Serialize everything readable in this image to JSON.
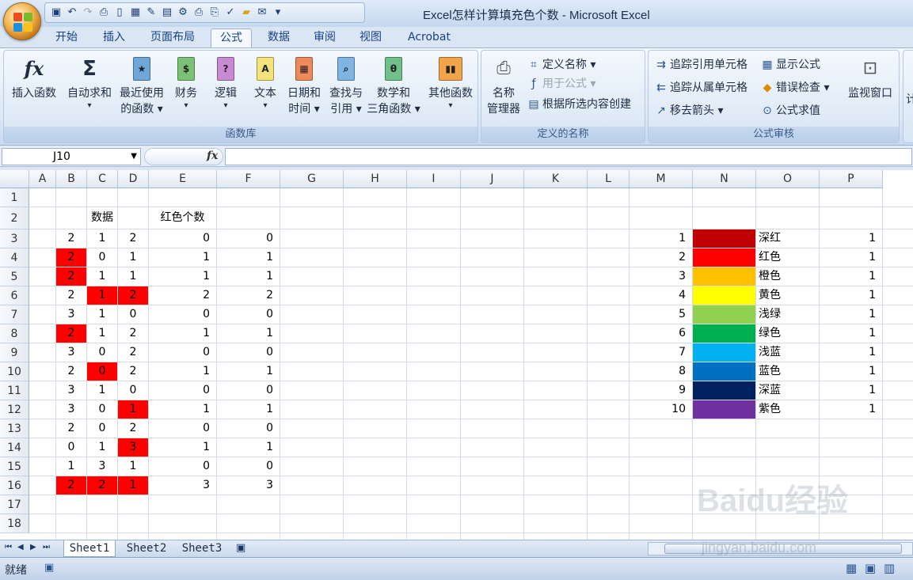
{
  "window": {
    "title": "Excel怎样计算填充色个数 - Microsoft Excel"
  },
  "tabs": [
    "开始",
    "插入",
    "页面布局",
    "公式",
    "数据",
    "审阅",
    "视图",
    "Acrobat"
  ],
  "active_tab": "公式",
  "ribbon": {
    "function_library": {
      "label": "函数库",
      "buttons": [
        {
          "line1": "插入函数",
          "line2": ""
        },
        {
          "line1": "自动求和",
          "line2": "▾"
        },
        {
          "line1": "最近使用",
          "line2": "的函数 ▾"
        },
        {
          "line1": "财务",
          "line2": "▾"
        },
        {
          "line1": "逻辑",
          "line2": "▾"
        },
        {
          "line1": "文本",
          "line2": "▾"
        },
        {
          "line1": "日期和",
          "line2": "时间 ▾"
        },
        {
          "line1": "查找与",
          "line2": "引用 ▾"
        },
        {
          "line1": "数学和",
          "line2": "三角函数 ▾"
        },
        {
          "line1": "其他函数",
          "line2": "▾"
        }
      ]
    },
    "defined_names": {
      "label": "定义的名称",
      "name_manager": {
        "line1": "名称",
        "line2": "管理器"
      },
      "define_name": "定义名称 ▾",
      "use_in_formula": "用于公式 ▾",
      "create_from_selection": "根据所选内容创建"
    },
    "formula_auditing": {
      "label": "公式审核",
      "trace_precedents": "追踪引用单元格",
      "trace_dependents": "追踪从属单元格",
      "remove_arrows": "移去箭头 ▾",
      "show_formulas": "显示公式",
      "error_checking": "错误检查 ▾",
      "evaluate_formula": "公式求值",
      "watch_window": "监视窗口"
    }
  },
  "formula_bar": {
    "name_box": "J10",
    "fx": "fx",
    "formula": ""
  },
  "columns": [
    "A",
    "B",
    "C",
    "D",
    "E",
    "F",
    "G",
    "H",
    "I",
    "J",
    "K",
    "L",
    "M",
    "N",
    "O",
    "P"
  ],
  "rows": [
    "1",
    "2",
    "3",
    "4",
    "5",
    "6",
    "7",
    "8",
    "9",
    "10",
    "11",
    "12",
    "13",
    "14",
    "15",
    "16",
    "17",
    "18"
  ],
  "headers": {
    "data": "数据",
    "red_count": "红色个数"
  },
  "data_rows": [
    {
      "b": "2",
      "c": "1",
      "d": "2",
      "e": "0",
      "f": "0",
      "red": [
        false,
        false,
        false
      ]
    },
    {
      "b": "2",
      "c": "0",
      "d": "1",
      "e": "1",
      "f": "1",
      "red": [
        true,
        false,
        false
      ]
    },
    {
      "b": "2",
      "c": "1",
      "d": "1",
      "e": "1",
      "f": "1",
      "red": [
        true,
        false,
        false
      ]
    },
    {
      "b": "2",
      "c": "1",
      "d": "2",
      "e": "2",
      "f": "2",
      "red": [
        false,
        true,
        true
      ]
    },
    {
      "b": "3",
      "c": "1",
      "d": "0",
      "e": "0",
      "f": "0",
      "red": [
        false,
        false,
        false
      ]
    },
    {
      "b": "2",
      "c": "1",
      "d": "2",
      "e": "1",
      "f": "1",
      "red": [
        true,
        false,
        false
      ]
    },
    {
      "b": "3",
      "c": "0",
      "d": "2",
      "e": "0",
      "f": "0",
      "red": [
        false,
        false,
        false
      ]
    },
    {
      "b": "2",
      "c": "0",
      "d": "2",
      "e": "1",
      "f": "1",
      "red": [
        false,
        true,
        false
      ]
    },
    {
      "b": "3",
      "c": "1",
      "d": "0",
      "e": "0",
      "f": "0",
      "red": [
        false,
        false,
        false
      ]
    },
    {
      "b": "3",
      "c": "0",
      "d": "1",
      "e": "1",
      "f": "1",
      "red": [
        false,
        false,
        true
      ]
    },
    {
      "b": "2",
      "c": "0",
      "d": "2",
      "e": "0",
      "f": "0",
      "red": [
        false,
        false,
        false
      ]
    },
    {
      "b": "0",
      "c": "1",
      "d": "3",
      "e": "1",
      "f": "1",
      "red": [
        false,
        false,
        true
      ]
    },
    {
      "b": "1",
      "c": "3",
      "d": "1",
      "e": "0",
      "f": "0",
      "red": [
        false,
        false,
        false
      ]
    },
    {
      "b": "2",
      "c": "2",
      "d": "1",
      "e": "3",
      "f": "3",
      "red": [
        true,
        true,
        true
      ]
    }
  ],
  "color_table": [
    {
      "n": "1",
      "color": "#c00000",
      "name": "深红",
      "p": "1"
    },
    {
      "n": "2",
      "color": "#ff0000",
      "name": "红色",
      "p": "1"
    },
    {
      "n": "3",
      "color": "#ffc000",
      "name": "橙色",
      "p": "1"
    },
    {
      "n": "4",
      "color": "#ffff00",
      "name": "黄色",
      "p": "1"
    },
    {
      "n": "5",
      "color": "#92d050",
      "name": "浅绿",
      "p": "1"
    },
    {
      "n": "6",
      "color": "#00b050",
      "name": "绿色",
      "p": "1"
    },
    {
      "n": "7",
      "color": "#00b0f0",
      "name": "浅蓝",
      "p": "1"
    },
    {
      "n": "8",
      "color": "#0070c0",
      "name": "蓝色",
      "p": "1"
    },
    {
      "n": "9",
      "color": "#002060",
      "name": "深蓝",
      "p": "1"
    },
    {
      "n": "10",
      "color": "#7030a0",
      "name": "紫色",
      "p": "1"
    }
  ],
  "sheet_tabs": [
    "Sheet1",
    "Sheet2",
    "Sheet3"
  ],
  "status": {
    "text": "就绪"
  },
  "watermark": {
    "brand": "Baidu经验",
    "url": "jingyan.baidu.com"
  }
}
